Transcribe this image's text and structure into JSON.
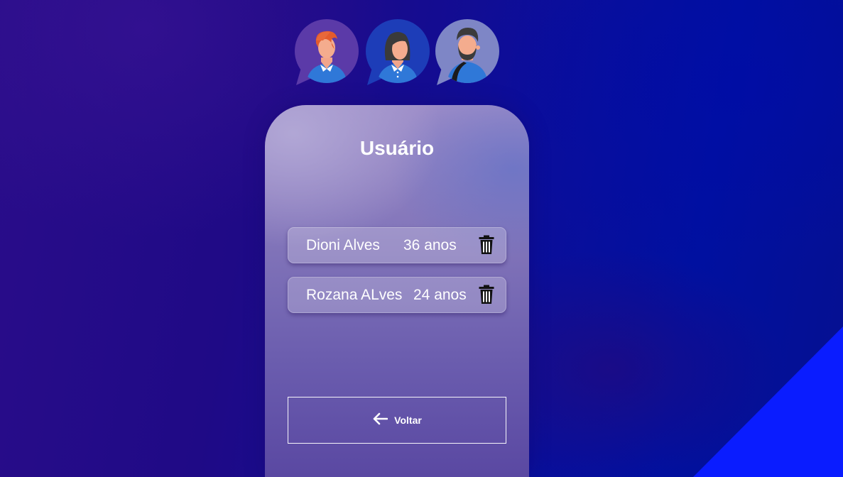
{
  "avatars": [
    {
      "icon": "avatar-red-hair-man-icon"
    },
    {
      "icon": "avatar-woman-icon"
    },
    {
      "icon": "avatar-bearded-man-icon"
    }
  ],
  "card": {
    "title": "Usuário",
    "users": [
      {
        "name": "Dioni Alves",
        "age": "36 anos",
        "action_icon": "trash-icon"
      },
      {
        "name": "Rozana ALves",
        "age": "24 anos",
        "action_icon": "trash-icon"
      }
    ],
    "back_button": {
      "label": "Voltar",
      "icon": "arrow-left-icon"
    }
  },
  "colors": {
    "background_left": "#2a0d8a",
    "background_right": "#0010a0",
    "corner_accent": "#0a1cff",
    "text": "#ffffff"
  }
}
